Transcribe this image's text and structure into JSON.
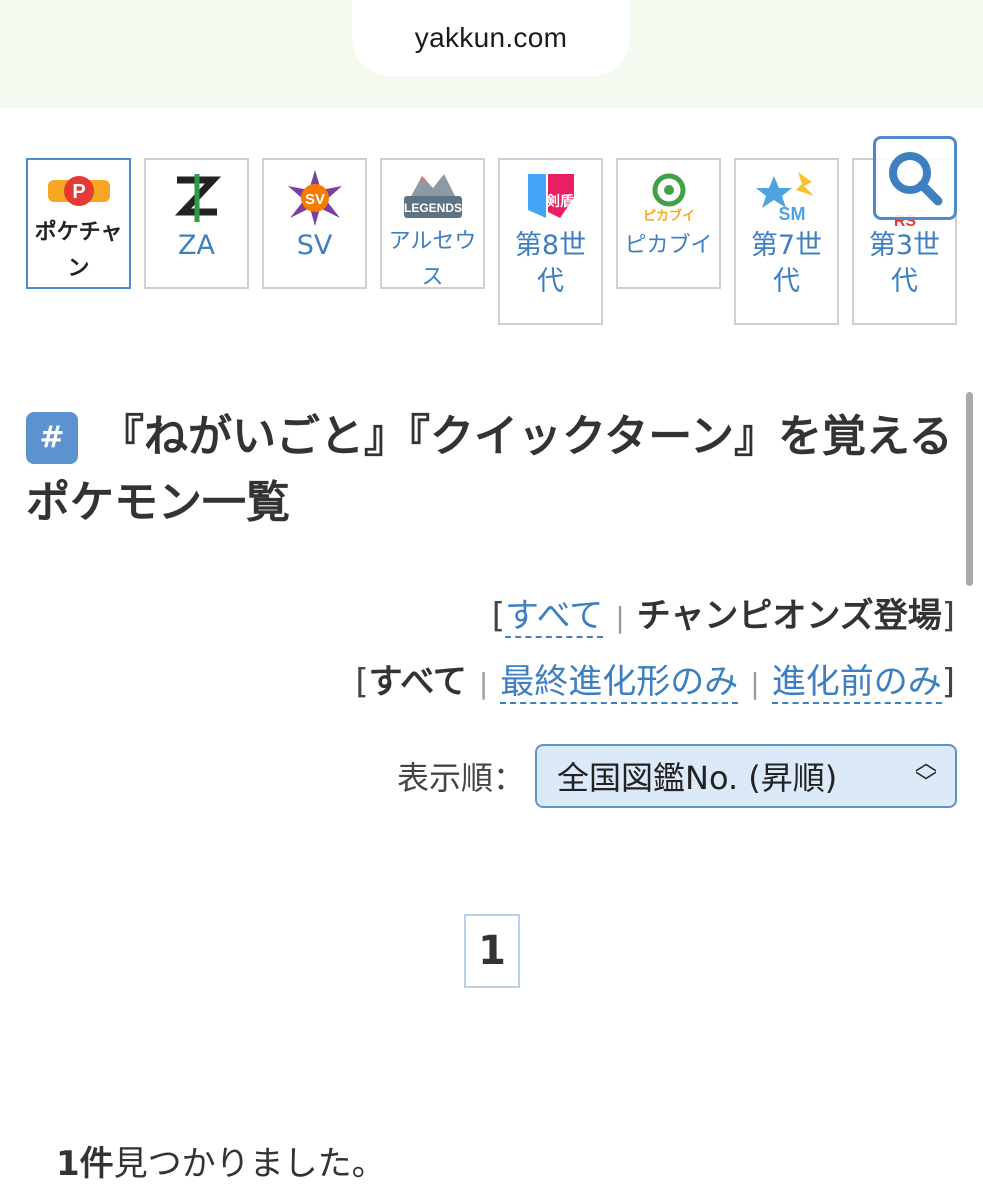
{
  "browser": {
    "url": "yakkun.com"
  },
  "tabs": [
    {
      "label": "ポケチャン",
      "logo": "champions-logo",
      "active": true
    },
    {
      "label": "ZA",
      "logo": "za-logo",
      "active": false
    },
    {
      "label": "SV",
      "logo": "sv-logo",
      "active": false
    },
    {
      "label": "アルセウス",
      "logo": "legends-logo",
      "logo_text": "LEGENDS",
      "active": false
    },
    {
      "label": "第8世代",
      "logo": "sword-shield-logo",
      "logo_text": "剣盾",
      "active": false
    },
    {
      "label": "ピカブイ",
      "logo": "letsgo-logo",
      "logo_text": "ピカブイ",
      "active": false
    },
    {
      "label": "第7世代",
      "logo": "sun-moon-logo",
      "logo_text": "SM",
      "active": false
    },
    {
      "label": "第3世代",
      "logo": "ruby-sapphire-logo",
      "logo_text": "RS",
      "active": false
    }
  ],
  "search": {
    "icon": "search-icon"
  },
  "heading": {
    "badge": "#",
    "title": "『ねがいごと』『クイックターン』を覚えるポケモン一覧"
  },
  "filter1": {
    "link": "すべて",
    "current": "チャンピオンズ登場"
  },
  "filter2": {
    "current": "すべて",
    "link1": "最終進化形のみ",
    "link2": "進化前のみ"
  },
  "sort": {
    "label": "表示順：",
    "value": "全国図鑑No. (昇順)"
  },
  "pagination": {
    "current": "1"
  },
  "result": {
    "count": "1件",
    "text": "見つかりました。"
  },
  "colors": {
    "accent": "#3d7fc1",
    "badge": "#5c93cf",
    "select_bg": "#dce9f8"
  }
}
